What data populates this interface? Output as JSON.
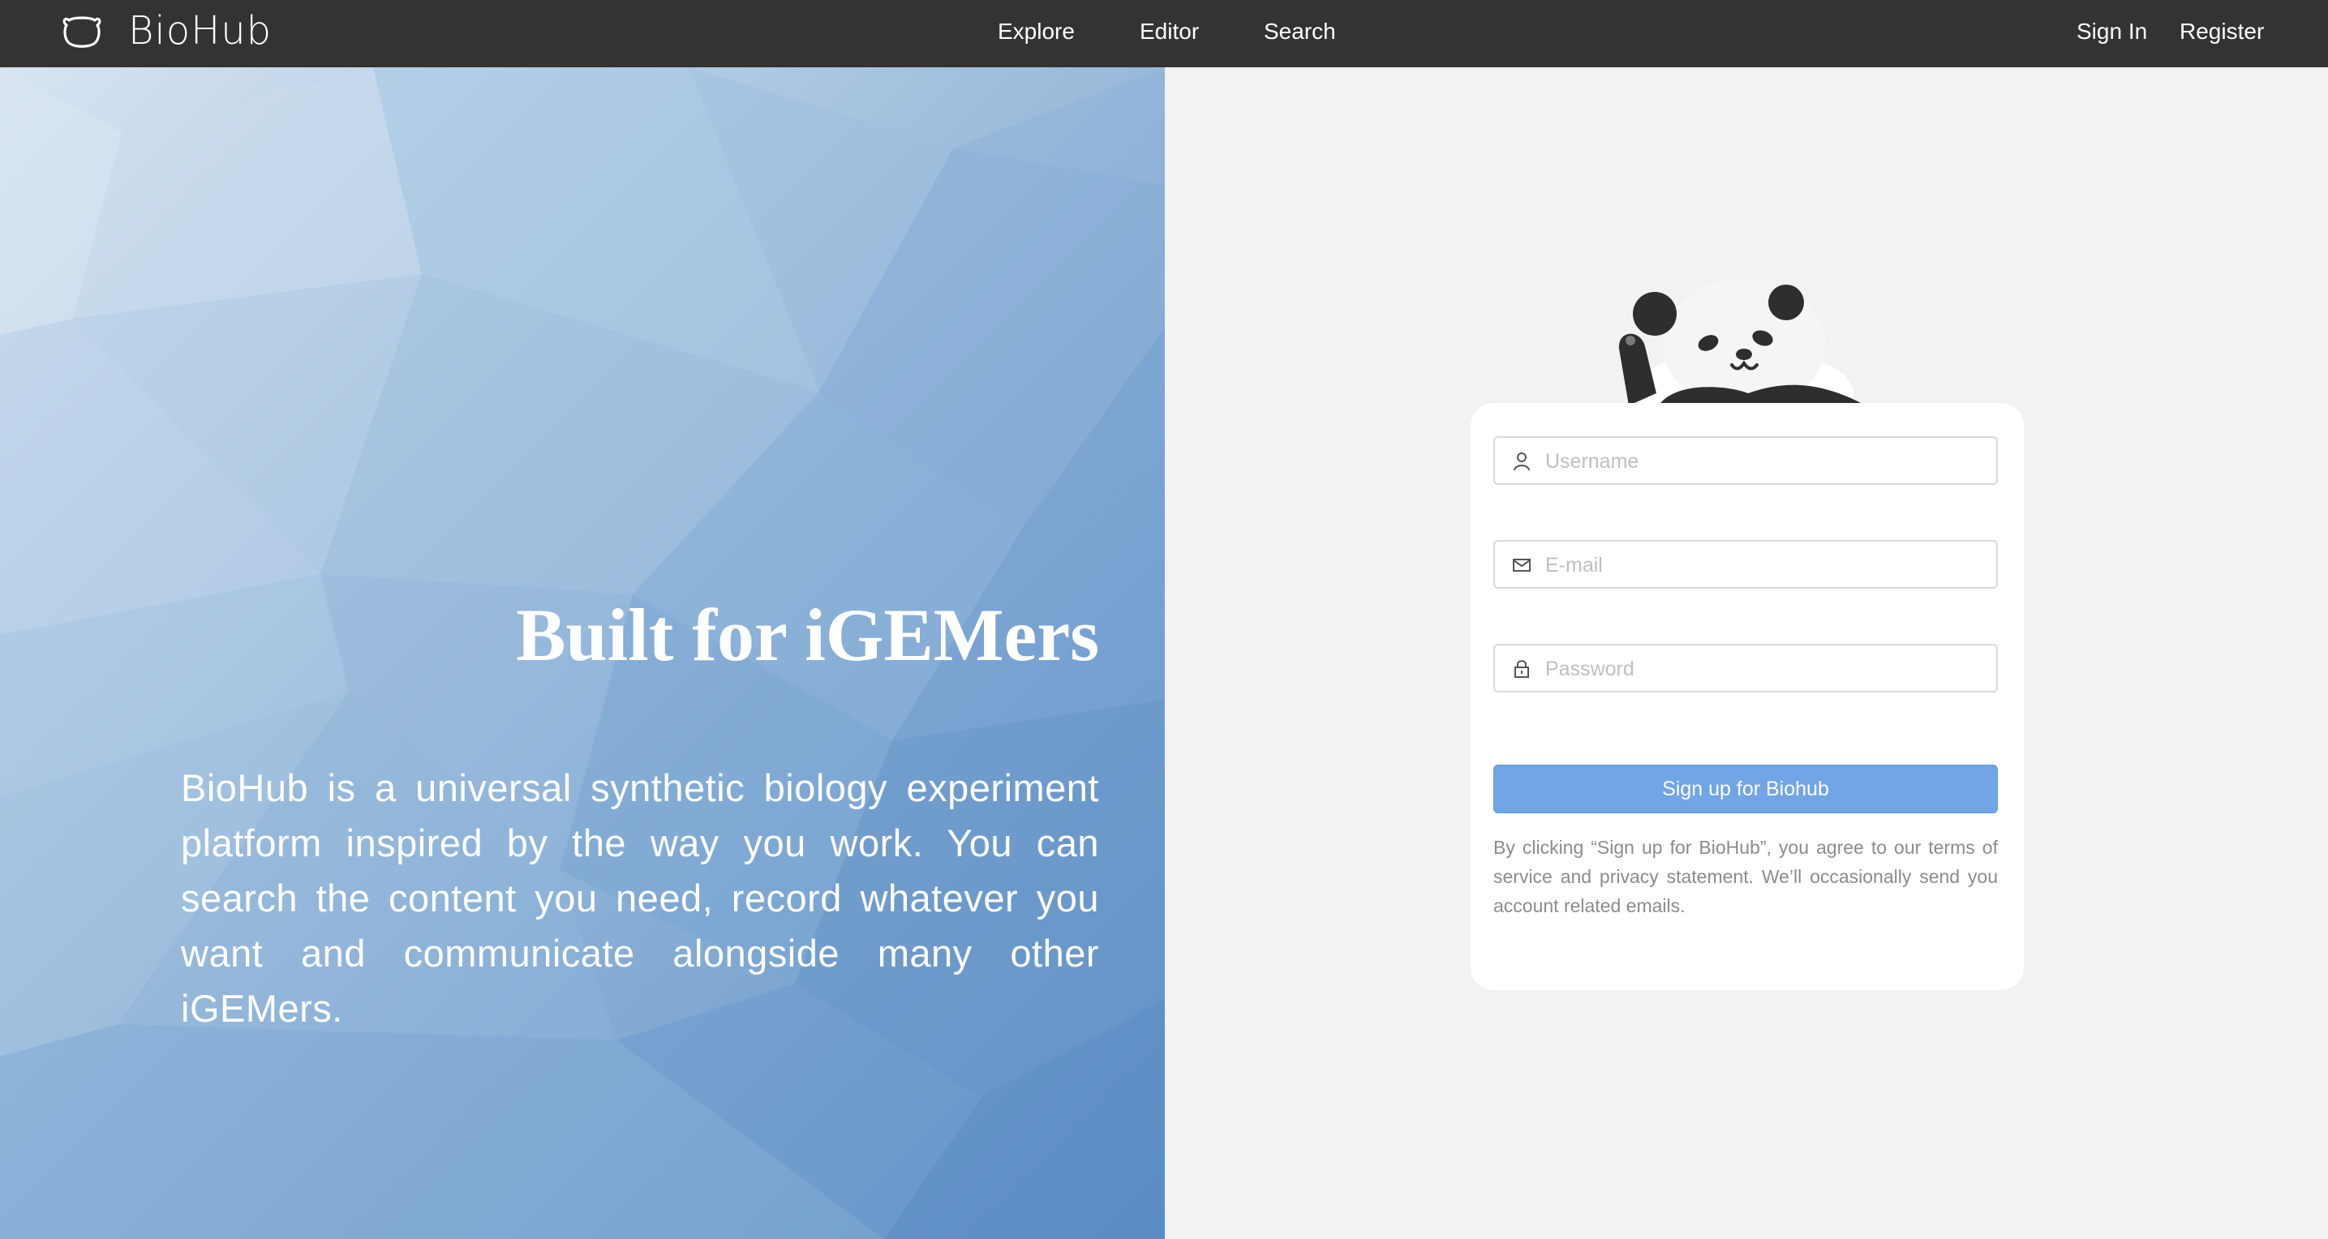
{
  "header": {
    "brand": "BioHub",
    "nav": [
      "Explore",
      "Editor",
      "Search"
    ],
    "sign_in": "Sign In",
    "register": "Register"
  },
  "hero": {
    "title": "Built for iGEMers",
    "description": "BioHub is a universal synthetic biology experiment platform inspired by the way you work. You can search the content you need, record whatever you want and communicate alongside many other iGEMers."
  },
  "form": {
    "username_placeholder": "Username",
    "email_placeholder": "E-mail",
    "password_placeholder": "Password",
    "submit_label": "Sign up for Biohub",
    "terms": "By clicking “Sign up for BioHub”, you agree to our terms of service and privacy statement. We’ll occasionally send you account related emails."
  },
  "icons": {
    "logo": "panda-head-icon",
    "username": "user-icon",
    "email": "mail-icon",
    "password": "lock-icon",
    "mascot": "waving-panda"
  },
  "colors": {
    "topbar": "#333333",
    "button": "#71a5e6",
    "background": "#f2f2f2"
  }
}
